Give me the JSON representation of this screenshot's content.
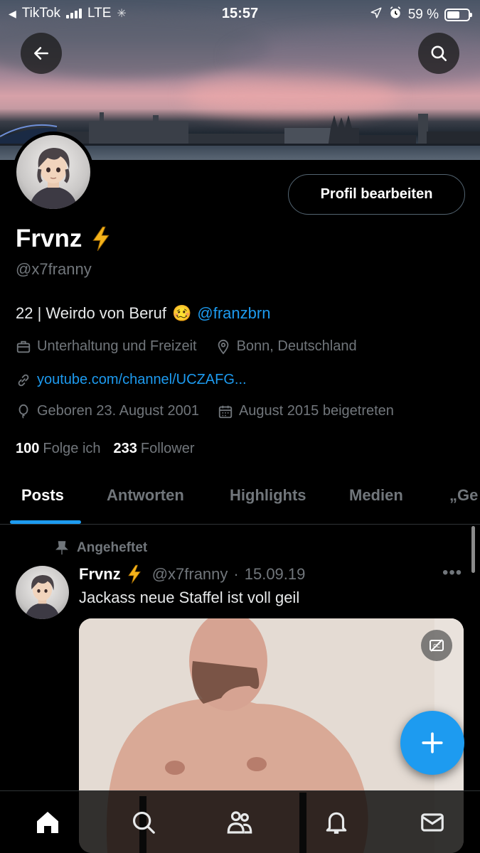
{
  "status_bar": {
    "back_app": "TikTok",
    "network": "LTE",
    "time": "15:57",
    "battery": "59 %",
    "battery_level": 0.59
  },
  "profile": {
    "name": "Frvnz",
    "handle": "@x7franny",
    "edit_button": "Profil bearbeiten",
    "bio_text": "22 | Weirdo von Beruf",
    "bio_emoji": "🥴",
    "bio_mention": "@franzbrn",
    "category": "Unterhaltung und Freizeit",
    "location": "Bonn, Deutschland",
    "website": "youtube.com/channel/UCZAFG...",
    "birthday": "Geboren 23. August 2001",
    "joined": "August 2015 beigetreten",
    "following_count": "100",
    "following_label": "Folge ich",
    "followers_count": "233",
    "followers_label": "Follower"
  },
  "tabs": [
    {
      "label": "Posts",
      "active": true
    },
    {
      "label": "Antworten",
      "active": false
    },
    {
      "label": "Highlights",
      "active": false
    },
    {
      "label": "Medien",
      "active": false
    },
    {
      "label": "„Ge",
      "active": false
    }
  ],
  "post": {
    "pinned_label": "Angeheftet",
    "author": "Frvnz",
    "handle": "@x7franny",
    "separator": "·",
    "date": "15.09.19",
    "text": "Jackass neue Staffel ist voll geil"
  },
  "colors": {
    "accent": "#1d9bf0",
    "background": "#000000",
    "secondary_text": "#71767b",
    "verified_bolt": "#f5b31a"
  },
  "icons": {
    "back": "arrow-left-icon",
    "search": "search-icon",
    "category": "briefcase-icon",
    "location": "location-pin-icon",
    "link": "link-icon",
    "birthday": "balloon-icon",
    "joined": "calendar-icon",
    "pin": "pin-icon",
    "compose": "plus-icon",
    "nav": [
      "home-icon",
      "search-icon",
      "communities-icon",
      "bell-icon",
      "mail-icon"
    ]
  }
}
